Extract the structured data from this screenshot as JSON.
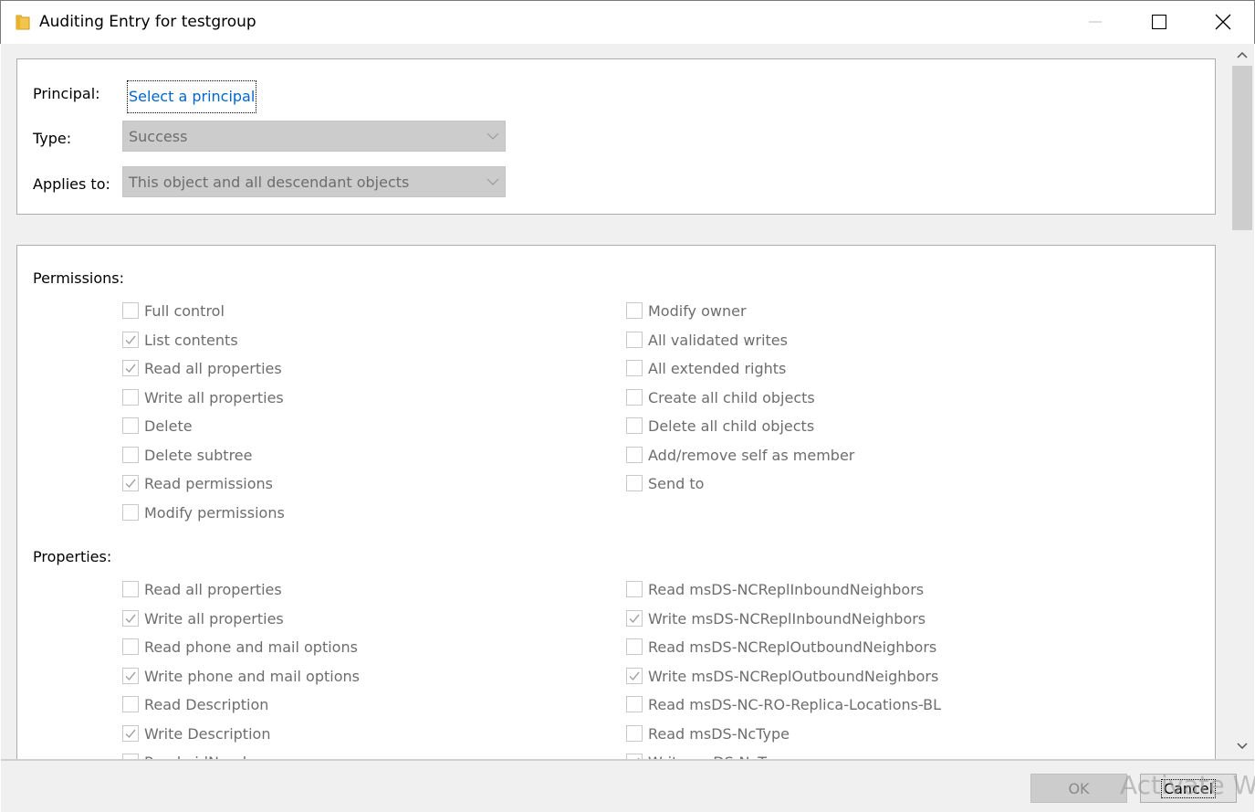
{
  "window": {
    "title": "Auditing Entry for testgroup",
    "icon": "folder-icon"
  },
  "header": {
    "principal_label": "Principal:",
    "principal_link": "Select a principal",
    "type_label": "Type:",
    "type_value": "Success",
    "applies_label": "Applies to:",
    "applies_value": "This object and all descendant objects"
  },
  "permissions": {
    "heading": "Permissions:",
    "left": [
      {
        "label": "Full control",
        "checked": false
      },
      {
        "label": "List contents",
        "checked": true
      },
      {
        "label": "Read all properties",
        "checked": true
      },
      {
        "label": "Write all properties",
        "checked": false
      },
      {
        "label": "Delete",
        "checked": false
      },
      {
        "label": "Delete subtree",
        "checked": false
      },
      {
        "label": "Read permissions",
        "checked": true
      },
      {
        "label": "Modify permissions",
        "checked": false
      }
    ],
    "right": [
      {
        "label": "Modify owner",
        "checked": false
      },
      {
        "label": "All validated writes",
        "checked": false
      },
      {
        "label": "All extended rights",
        "checked": false
      },
      {
        "label": "Create all child objects",
        "checked": false
      },
      {
        "label": "Delete all child objects",
        "checked": false
      },
      {
        "label": "Add/remove self as member",
        "checked": false
      },
      {
        "label": "Send to",
        "checked": false
      }
    ]
  },
  "properties": {
    "heading": "Properties:",
    "left": [
      {
        "label": "Read all properties",
        "checked": false
      },
      {
        "label": "Write all properties",
        "checked": true
      },
      {
        "label": "Read phone and mail options",
        "checked": false
      },
      {
        "label": "Write phone and mail options",
        "checked": true
      },
      {
        "label": "Read Description",
        "checked": false
      },
      {
        "label": "Write Description",
        "checked": true
      },
      {
        "label": "Read uidNumber",
        "checked": false
      }
    ],
    "right": [
      {
        "label": "Read msDS-NCReplInboundNeighbors",
        "checked": false
      },
      {
        "label": "Write msDS-NCReplInboundNeighbors",
        "checked": true
      },
      {
        "label": "Read msDS-NCReplOutboundNeighbors",
        "checked": false
      },
      {
        "label": "Write msDS-NCReplOutboundNeighbors",
        "checked": true
      },
      {
        "label": "Read msDS-NC-RO-Replica-Locations-BL",
        "checked": false
      },
      {
        "label": "Read msDS-NcType",
        "checked": false
      },
      {
        "label": "Write msDS-NcType",
        "checked": true
      }
    ]
  },
  "footer": {
    "ok_label": "OK",
    "cancel_label": "Cancel",
    "watermark": "Activate Wi"
  }
}
